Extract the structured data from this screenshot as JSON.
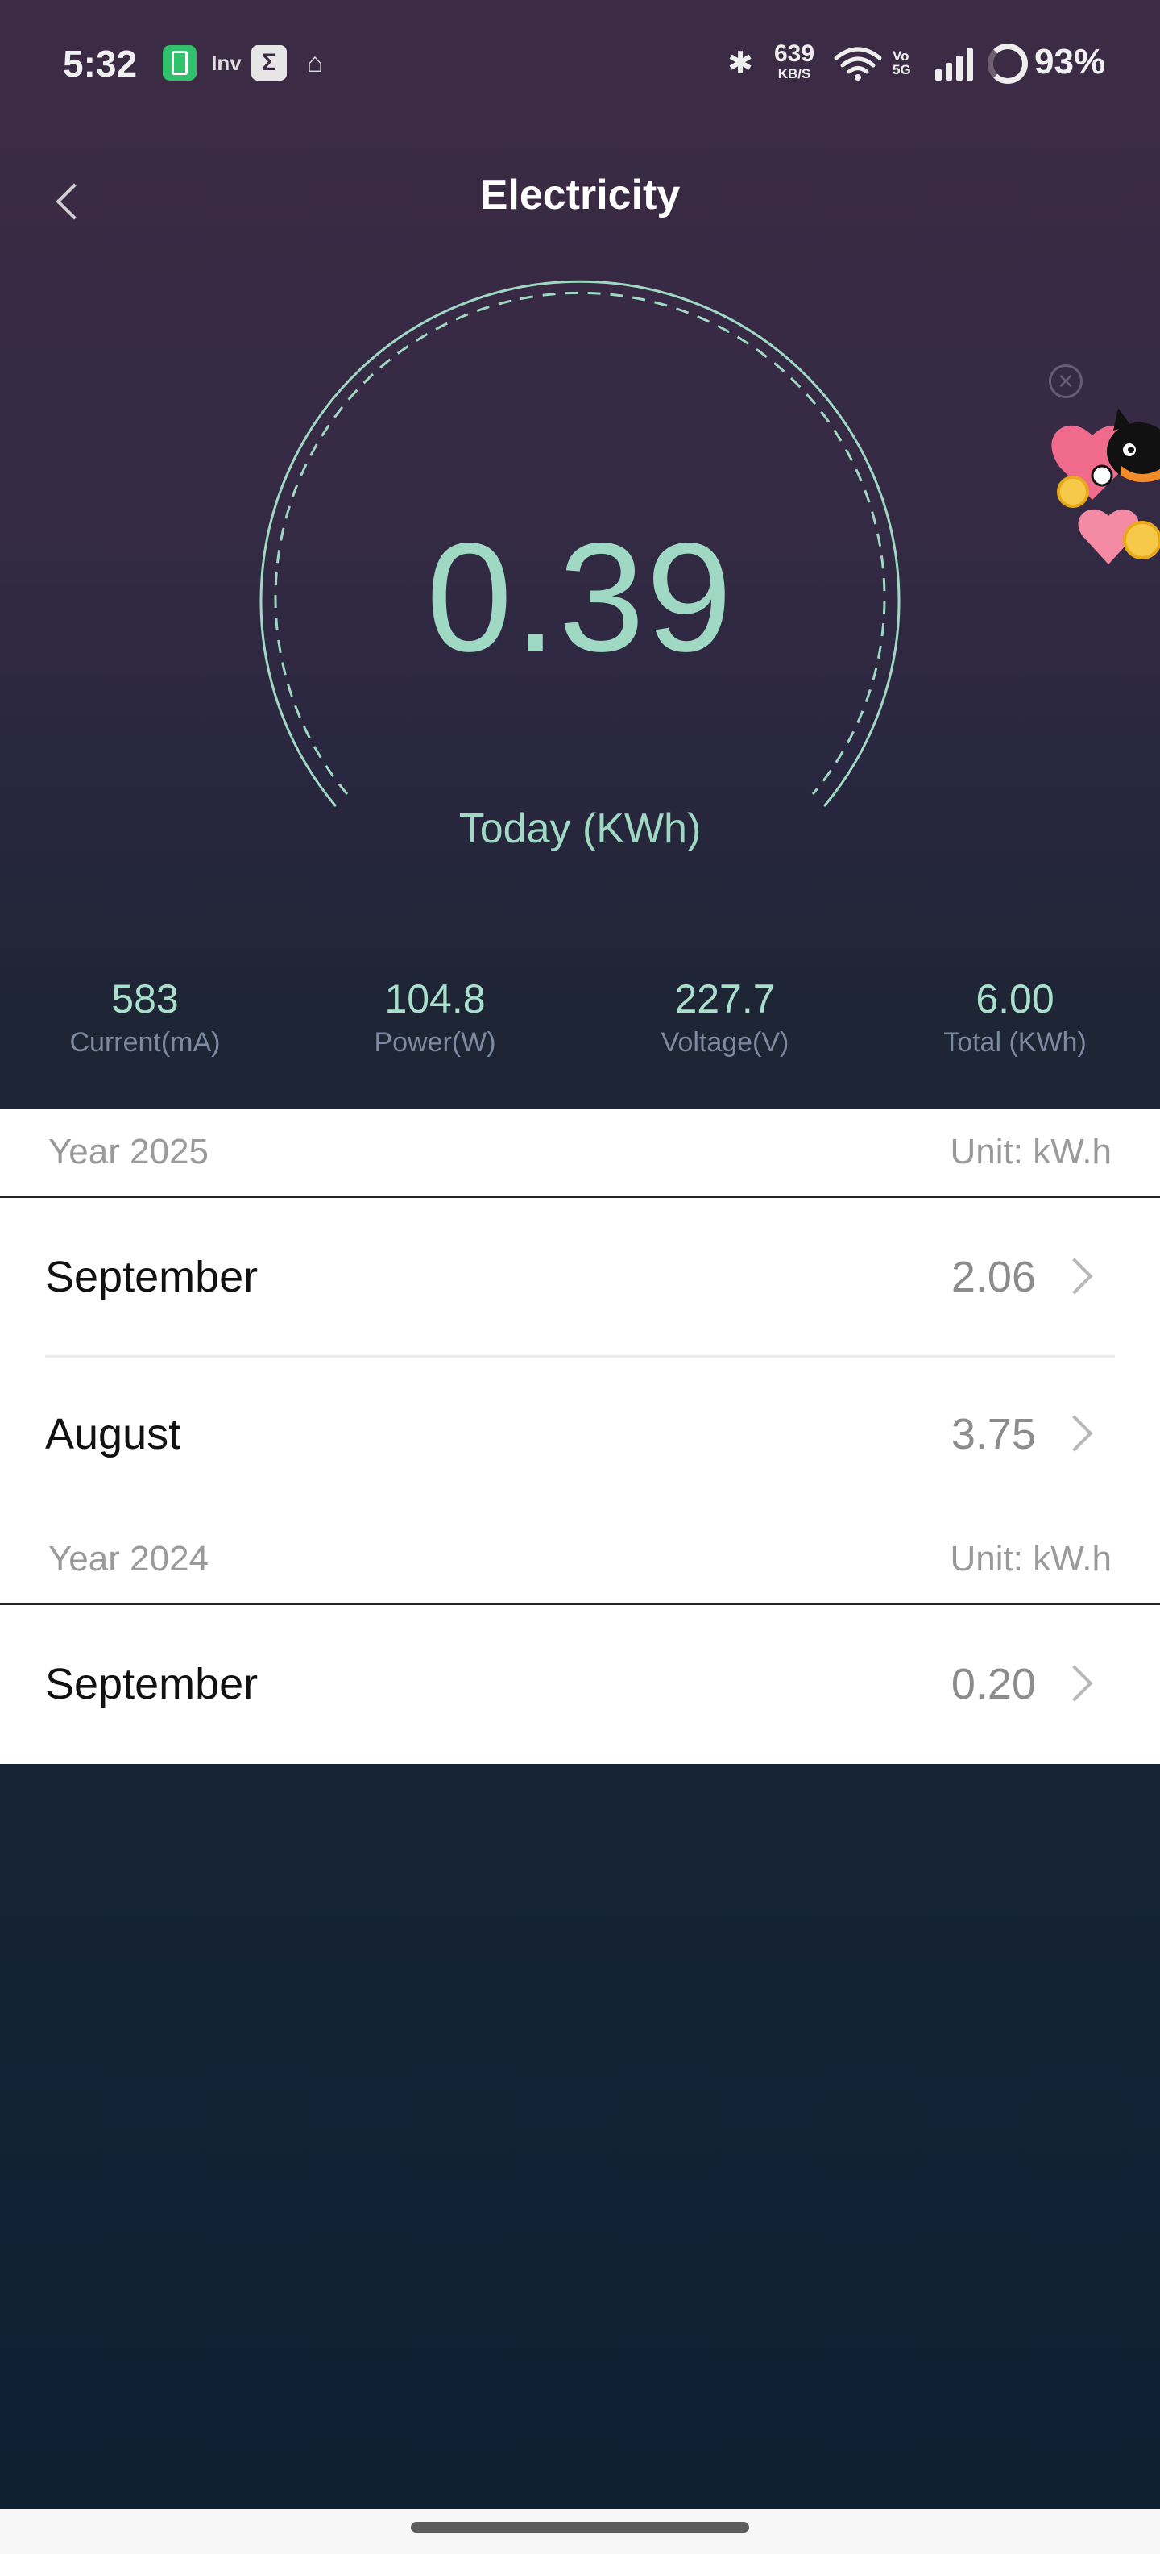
{
  "status_bar": {
    "time": "5:32",
    "inv_label": "Inv",
    "sigma_label": "Σ",
    "net_speed_value": "639",
    "net_speed_unit": "KB/S",
    "volte_label": "Vo 5G",
    "battery": "93%"
  },
  "header": {
    "title": "Electricity"
  },
  "gauge": {
    "value": "0.39",
    "label": "Today (KWh)",
    "accent_color": "#9fd9c3"
  },
  "stats": [
    {
      "value": "583",
      "label": "Current(mA)"
    },
    {
      "value": "104.8",
      "label": "Power(W)"
    },
    {
      "value": "227.7",
      "label": "Voltage(V)"
    },
    {
      "value": "6.00",
      "label": "Total (KWh)"
    }
  ],
  "history": {
    "groups": [
      {
        "year": "Year 2025",
        "unit": "Unit: kW.h",
        "months": [
          {
            "month": "September",
            "value": "2.06"
          },
          {
            "month": "August",
            "value": "3.75"
          }
        ]
      },
      {
        "year": "Year 2024",
        "unit": "Unit: kW.h",
        "months": [
          {
            "month": "September",
            "value": "0.20"
          }
        ]
      }
    ]
  },
  "icons": {
    "back": "chevron-left-icon",
    "row": "chevron-right-icon",
    "sticker_close": "close-circle-icon"
  }
}
